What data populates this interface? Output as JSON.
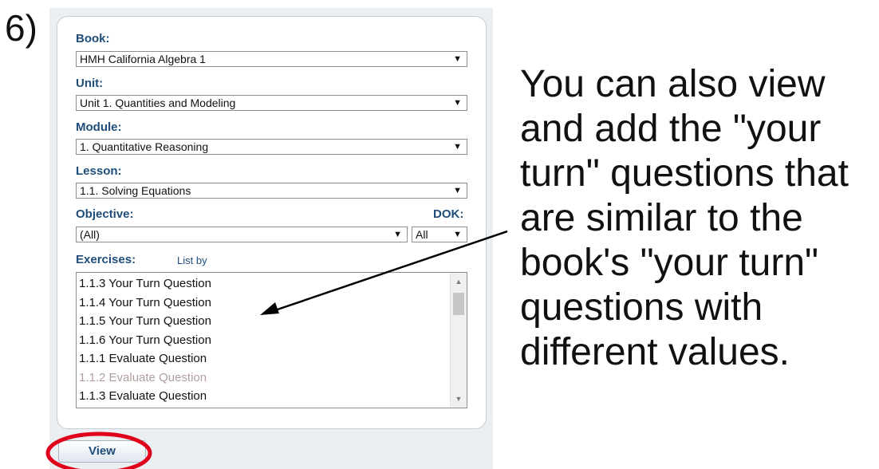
{
  "step_number": "6)",
  "form": {
    "book": {
      "label": "Book:",
      "value": "HMH California Algebra 1"
    },
    "unit": {
      "label": "Unit:",
      "value": "Unit 1. Quantities and Modeling"
    },
    "module": {
      "label": "Module:",
      "value": "1. Quantitative Reasoning"
    },
    "lesson": {
      "label": "Lesson:",
      "value": "1.1. Solving Equations"
    },
    "objective": {
      "label": "Objective:",
      "value": "(All)"
    },
    "dok": {
      "label": "DOK:",
      "value": "All"
    },
    "exercises": {
      "label": "Exercises:",
      "list_by": "List by",
      "items": [
        {
          "text": "1.1.3 Your Turn Question",
          "state": "enabled"
        },
        {
          "text": "1.1.4 Your Turn Question",
          "state": "enabled"
        },
        {
          "text": "1.1.5 Your Turn Question",
          "state": "enabled"
        },
        {
          "text": "1.1.6 Your Turn Question",
          "state": "enabled"
        },
        {
          "text": "1.1.1 Evaluate Question",
          "state": "enabled"
        },
        {
          "text": "1.1.2 Evaluate Question",
          "state": "disabled"
        },
        {
          "text": "1.1.3 Evaluate Question",
          "state": "enabled"
        }
      ]
    }
  },
  "view_button": {
    "label": "View"
  },
  "annotation": {
    "lines": [
      "You can also view",
      "and add the \"your",
      "turn\" questions that",
      "are similar to the",
      "book's \"your turn\"",
      "questions with",
      "different values."
    ]
  },
  "icons": {
    "dropdown": "chevron-down-icon",
    "scroll_up": "scroll-up-icon",
    "scroll_down": "scroll-down-icon"
  },
  "colors": {
    "label_blue": "#1f4d7a",
    "panel_gray": "#eceff2",
    "highlight_red": "#e0001b",
    "disabled_text": "#b19d9d"
  }
}
